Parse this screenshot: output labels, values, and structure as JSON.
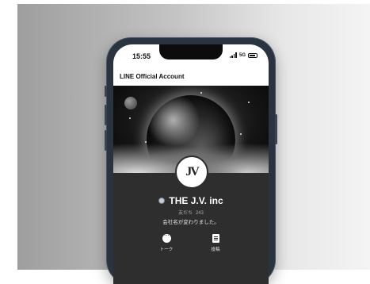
{
  "status_bar": {
    "time": "15:55",
    "network": "5G"
  },
  "app_bar": {
    "title": "LINE Official Account"
  },
  "profile": {
    "avatar_logo": "JV",
    "name": "THE J.V. inc",
    "friends_label": "友だち",
    "friends_count": "243",
    "status_message": "会社名が変わりました。",
    "verified_badge_color": "#c8ccd2"
  },
  "actions": [
    {
      "label": "トーク",
      "icon": "chat-bubble-icon"
    },
    {
      "label": "投稿",
      "icon": "post-document-icon"
    }
  ],
  "colors": {
    "screen_bg": "#2e2e2e",
    "phone_frame": "#2a3340",
    "text_primary": "#ffffff"
  }
}
